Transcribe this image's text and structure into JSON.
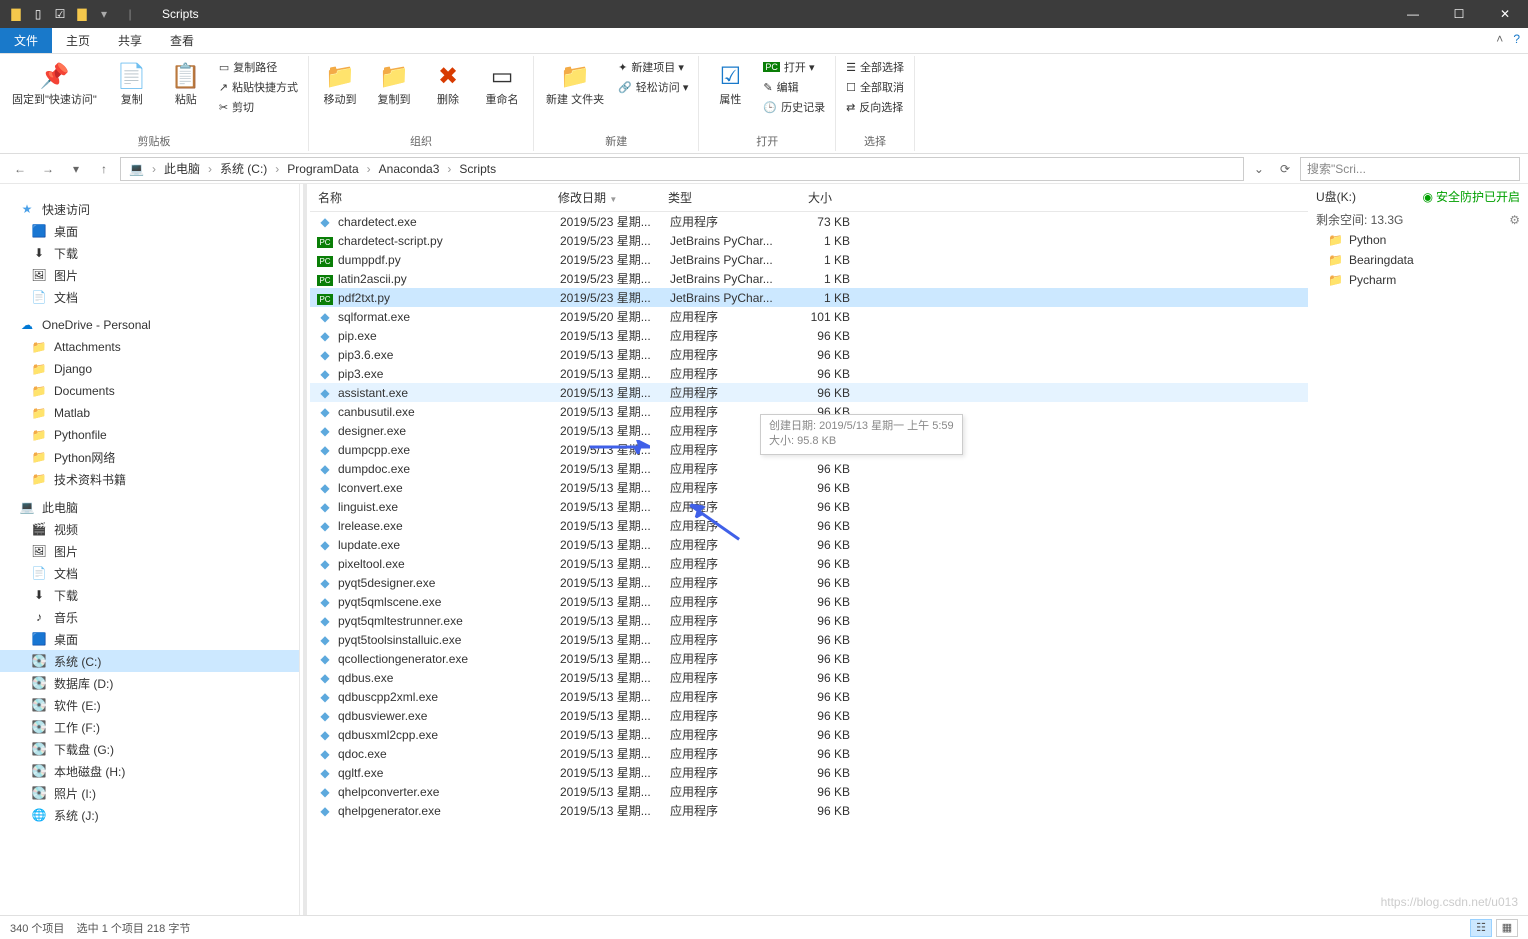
{
  "window": {
    "title": "Scripts"
  },
  "wincontrols": {
    "min": "—",
    "max": "☐",
    "close": "✕"
  },
  "tabs": {
    "file": "文件",
    "home": "主页",
    "share": "共享",
    "view": "查看"
  },
  "ribbon": {
    "clipboard": {
      "pin": "固定到\"快速访问\"",
      "copy": "复制",
      "paste": "粘贴",
      "copypath": "复制路径",
      "pasteshortcut": "粘贴快捷方式",
      "cut": "剪切",
      "label": "剪贴板"
    },
    "organize": {
      "moveto": "移动到",
      "copyto": "复制到",
      "delete": "删除",
      "rename": "重命名",
      "label": "组织"
    },
    "new": {
      "newfolder": "新建\n文件夹",
      "newitem": "新建项目 ▾",
      "easyaccess": "轻松访问 ▾",
      "label": "新建"
    },
    "open": {
      "properties": "属性",
      "open": "打开 ▾",
      "edit": "编辑",
      "history": "历史记录",
      "label": "打开"
    },
    "select": {
      "selectall": "全部选择",
      "selectnone": "全部取消",
      "invert": "反向选择",
      "label": "选择"
    }
  },
  "breadcrumb": {
    "pc": "此电脑",
    "c": "系统 (C:)",
    "p1": "ProgramData",
    "p2": "Anaconda3",
    "p3": "Scripts",
    "sep": "›"
  },
  "search": {
    "placeholder": "搜索\"Scri..."
  },
  "nav": {
    "quick": "快速访问",
    "quick_items": [
      "桌面",
      "下载",
      "图片",
      "文档"
    ],
    "onedrive": "OneDrive - Personal",
    "od_items": [
      "Attachments",
      "Django",
      "Documents",
      "Matlab",
      "Pythonfile",
      "Python网络",
      "技术资料书籍"
    ],
    "thispc": "此电脑",
    "pc_items": [
      "视频",
      "图片",
      "文档",
      "下载",
      "音乐",
      "桌面",
      "系统 (C:)",
      "数据库 (D:)",
      "软件 (E:)",
      "工作 (F:)",
      "下载盘 (G:)",
      "本地磁盘 (H:)",
      "照片 (I:)",
      "系统 (J:)"
    ]
  },
  "cols": {
    "name": "名称",
    "date": "修改日期",
    "type": "类型",
    "size": "大小"
  },
  "type_app": "应用程序",
  "type_jb": "JetBrains PyChar...",
  "dates": {
    "d523": "2019/5/23 星期...",
    "d520": "2019/5/20 星期...",
    "d513": "2019/5/13 星期..."
  },
  "files": [
    {
      "n": "chardetect.exe",
      "d": "d523",
      "t": "app",
      "s": "73 KB"
    },
    {
      "n": "chardetect-script.py",
      "d": "d523",
      "t": "jb",
      "s": "1 KB"
    },
    {
      "n": "dumppdf.py",
      "d": "d523",
      "t": "jb",
      "s": "1 KB"
    },
    {
      "n": "latin2ascii.py",
      "d": "d523",
      "t": "jb",
      "s": "1 KB"
    },
    {
      "n": "pdf2txt.py",
      "d": "d523",
      "t": "jb",
      "s": "1 KB",
      "sel": true
    },
    {
      "n": "sqlformat.exe",
      "d": "d520",
      "t": "app",
      "s": "101 KB"
    },
    {
      "n": "pip.exe",
      "d": "d513",
      "t": "app",
      "s": "96 KB"
    },
    {
      "n": "pip3.6.exe",
      "d": "d513",
      "t": "app",
      "s": "96 KB"
    },
    {
      "n": "pip3.exe",
      "d": "d513",
      "t": "app",
      "s": "96 KB"
    },
    {
      "n": "assistant.exe",
      "d": "d513",
      "t": "app",
      "s": "96 KB",
      "hov": true
    },
    {
      "n": "canbusutil.exe",
      "d": "d513",
      "t": "app",
      "s": "96 KB"
    },
    {
      "n": "designer.exe",
      "d": "d513",
      "t": "app",
      "s": "96 KB"
    },
    {
      "n": "dumpcpp.exe",
      "d": "d513",
      "t": "app",
      "s": "96 KB"
    },
    {
      "n": "dumpdoc.exe",
      "d": "d513",
      "t": "app",
      "s": "96 KB"
    },
    {
      "n": "lconvert.exe",
      "d": "d513",
      "t": "app",
      "s": "96 KB"
    },
    {
      "n": "linguist.exe",
      "d": "d513",
      "t": "app",
      "s": "96 KB"
    },
    {
      "n": "lrelease.exe",
      "d": "d513",
      "t": "app",
      "s": "96 KB"
    },
    {
      "n": "lupdate.exe",
      "d": "d513",
      "t": "app",
      "s": "96 KB"
    },
    {
      "n": "pixeltool.exe",
      "d": "d513",
      "t": "app",
      "s": "96 KB"
    },
    {
      "n": "pyqt5designer.exe",
      "d": "d513",
      "t": "app",
      "s": "96 KB"
    },
    {
      "n": "pyqt5qmlscene.exe",
      "d": "d513",
      "t": "app",
      "s": "96 KB"
    },
    {
      "n": "pyqt5qmltestrunner.exe",
      "d": "d513",
      "t": "app",
      "s": "96 KB"
    },
    {
      "n": "pyqt5toolsinstalluic.exe",
      "d": "d513",
      "t": "app",
      "s": "96 KB"
    },
    {
      "n": "qcollectiongenerator.exe",
      "d": "d513",
      "t": "app",
      "s": "96 KB"
    },
    {
      "n": "qdbus.exe",
      "d": "d513",
      "t": "app",
      "s": "96 KB"
    },
    {
      "n": "qdbuscpp2xml.exe",
      "d": "d513",
      "t": "app",
      "s": "96 KB"
    },
    {
      "n": "qdbusviewer.exe",
      "d": "d513",
      "t": "app",
      "s": "96 KB"
    },
    {
      "n": "qdbusxml2cpp.exe",
      "d": "d513",
      "t": "app",
      "s": "96 KB"
    },
    {
      "n": "qdoc.exe",
      "d": "d513",
      "t": "app",
      "s": "96 KB"
    },
    {
      "n": "qgltf.exe",
      "d": "d513",
      "t": "app",
      "s": "96 KB"
    },
    {
      "n": "qhelpconverter.exe",
      "d": "d513",
      "t": "app",
      "s": "96 KB"
    },
    {
      "n": "qhelpgenerator.exe",
      "d": "d513",
      "t": "app",
      "s": "96 KB"
    }
  ],
  "tooltip": {
    "l1": "创建日期: 2019/5/13 星期一 上午 5:59",
    "l2": "大小: 95.8 KB"
  },
  "rightpanel": {
    "drive": "U盘(K:)",
    "security": "安全防护已开启",
    "free": "剩余空间: 13.3G",
    "folders": [
      "Python",
      "Bearingdata",
      "Pycharm"
    ]
  },
  "status": {
    "count": "340 个项目",
    "sel": "选中 1 个项目  218 字节"
  },
  "watermark": "https://blog.csdn.net/u013"
}
